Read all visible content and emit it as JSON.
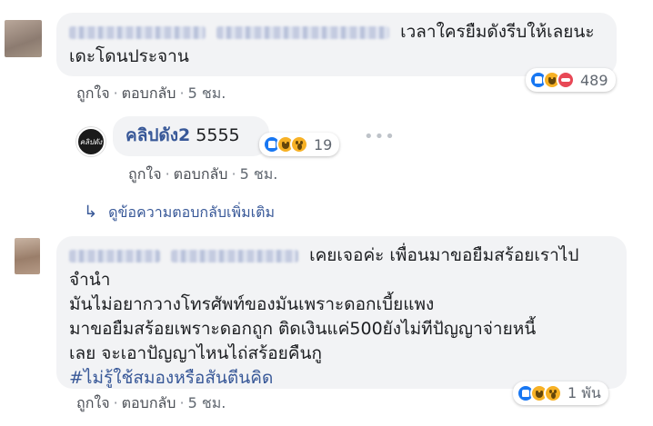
{
  "comments": [
    {
      "text_line1": "เวลาใครยืมดังรีบให้เลยนะ",
      "text_line2": "เดะโดนประจาน",
      "actions": {
        "like": "ถูกใจ",
        "reply": "ตอบกลับ",
        "time": "5 ชม."
      },
      "reactions": {
        "icons": [
          "like-icon",
          "haha-icon",
          "angry-icon"
        ],
        "count": "489"
      }
    },
    {
      "page_logo_text": "คลิปดัง",
      "author": "คลิปดัง2",
      "text": "5555",
      "actions": {
        "like": "ถูกใจ",
        "reply": "ตอบกลับ",
        "time": "5 ชม."
      },
      "reactions": {
        "icons": [
          "like-icon",
          "haha-icon",
          "wow-icon"
        ],
        "count": "19"
      },
      "more": "•••"
    },
    {
      "see_more": "ดูข้อความตอบกลับเพิ่มเติม"
    },
    {
      "text_line1": "เคยเจอค่ะ เพื่อนมาขอยืมสร้อยเราไป",
      "text_line2": "จำนำ",
      "text_line3": "มันไม่อยากวางโทรศัพท์ของมันเพราะดอกเบี้ยแพง",
      "text_line4": "มาขอยืมสร้อยเพราะดอกถูก ติดเงินแค่500ยังไม่ทีปัญญาจ่ายหนี้",
      "text_line5": "เลย จะเอาปัญญาไหนไถ่สร้อยคืนกู",
      "hashtag": "#ไม่รู้ใช้สมองหรือสันตีนคิด",
      "actions": {
        "like": "ถูกใจ",
        "reply": "ตอบกลับ",
        "time": "5 ชม."
      },
      "reactions": {
        "icons": [
          "like-icon",
          "haha-icon",
          "wow-icon"
        ],
        "count": "1 พัน"
      }
    }
  ],
  "colors": {
    "link": "#385898",
    "bubble": "#f2f3f5",
    "like": "#1877f2",
    "haha": "#f7b125",
    "angry": "#e84856"
  }
}
